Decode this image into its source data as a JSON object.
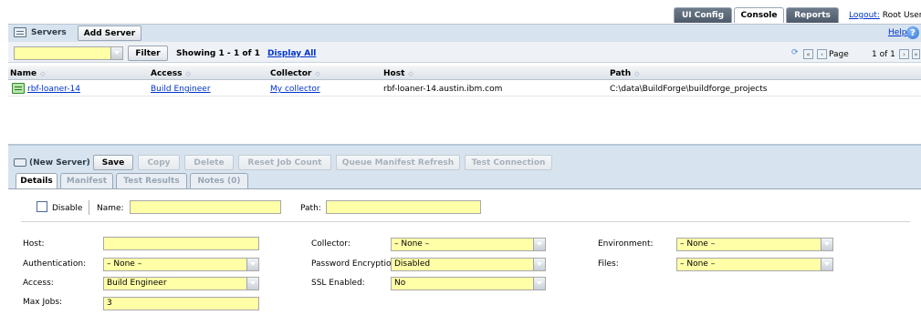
{
  "top_tabs": {
    "ui_config": "UI Config",
    "console": "Console",
    "reports": "Reports",
    "logout_link": "Logout:",
    "user": "Root User"
  },
  "header": {
    "title": "Servers",
    "add_server": "Add Server",
    "help": "Help"
  },
  "filter_bar": {
    "filter_value": "",
    "filter_button": "Filter",
    "showing_label": "Showing 1 -",
    "showing_of": "1 of 1",
    "display_all": "Display All",
    "page_label": "Page",
    "page_of": "1 of 1"
  },
  "table": {
    "columns": [
      "Name",
      "Access",
      "Collector",
      "Host",
      "Path"
    ],
    "rows": [
      {
        "name": "rbf-loaner-14",
        "access": "Build Engineer",
        "collector": "My collector",
        "host": "rbf-loaner-14.austin.ibm.com",
        "path": "C:\\data\\BuildForge\\buildforge_projects"
      }
    ]
  },
  "toolbar": {
    "record_label": "(New Server)",
    "save": "Save",
    "copy": "Copy",
    "delete": "Delete",
    "reset_job_count": "Reset Job Count",
    "queue_manifest_refresh": "Queue Manifest Refresh",
    "test_connection": "Test Connection"
  },
  "detail_tabs": {
    "details": "Details",
    "manifest": "Manifest",
    "test_results": "Test Results",
    "notes": "Notes (0)"
  },
  "form": {
    "disable_label": "Disable",
    "name_label": "Name:",
    "name_value": "",
    "path_label": "Path:",
    "path_value": "",
    "host_label": "Host:",
    "host_value": "",
    "authentication_label": "Authentication:",
    "authentication_value": "– None –",
    "access_label": "Access:",
    "access_value": "Build Engineer",
    "max_jobs_label": "Max Jobs:",
    "max_jobs_value": "3",
    "collector_label": "Collector:",
    "collector_value": "– None –",
    "password_encryption_label": "Password Encryption:",
    "password_encryption_value": "Disabled",
    "ssl_enabled_label": "SSL Enabled:",
    "ssl_enabled_value": "No",
    "environment_label": "Environment:",
    "environment_value": "– None –",
    "files_label": "Files:",
    "files_value": "– None –"
  },
  "colors": {
    "header_bg": "#d7e3ee",
    "field_bg": "#ffffa8",
    "link": "#0033cc",
    "tab_active": "#ffffff",
    "tab_inactive": "#4c5a6a"
  }
}
